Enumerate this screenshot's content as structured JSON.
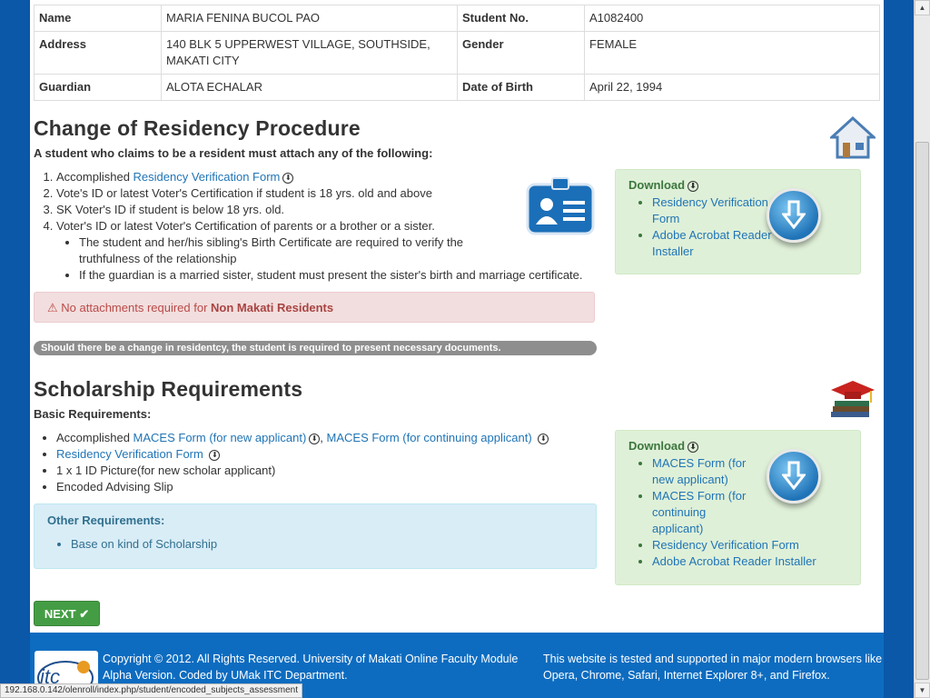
{
  "student": {
    "name_label": "Name",
    "name": "MARIA FENINA BUCOL PAO",
    "studno_label": "Student No.",
    "studno": "A1082400",
    "address_label": "Address",
    "address": "140 BLK 5 UPPERWEST VILLAGE, SOUTHSIDE, MAKATI CITY",
    "gender_label": "Gender",
    "gender": "FEMALE",
    "guardian_label": "Guardian",
    "guardian": "ALOTA ECHALAR",
    "dob_label": "Date of Birth",
    "dob": "April 22, 1994"
  },
  "residency": {
    "title": "Change of Residency Procedure",
    "subtitle": "A student who claims to be a resident must attach any of the following:",
    "item1_prefix": "Accomplished ",
    "item1_link": "Residency Verification Form",
    "item2": "Vote's ID or latest Voter's Certification if student is 18 yrs. old and above",
    "item3": "SK Voter's ID if student is below 18 yrs. old.",
    "item4": "Voter's ID or latest Voter's Certification of parents or a brother or a sister.",
    "sub1": "The student and her/his sibling's Birth Certificate are required to verify the truthfulness of the relationship",
    "sub2": "If the guardian is a married sister, student must present the sister's birth and marriage certificate.",
    "alert_prefix": "No attachments required for ",
    "alert_bold": "Non Makati Residents",
    "bar_text": "Should there be a change in residentcy, the student is required to present necessary documents.",
    "download_title": "Download",
    "downloads": [
      "Residency Verification Form",
      "Adobe Acrobat Reader Installer"
    ]
  },
  "scholarship": {
    "title": "Scholarship Requirements",
    "subtitle": "Basic Requirements:",
    "item1_prefix": "Accomplished ",
    "item1_link1": "MACES Form (for new applicant)",
    "item1_link2": "MACES Form (for continuing applicant)",
    "item2_link": "Residency Verification Form",
    "item3": "1 x 1 ID Picture(for new scholar applicant)",
    "item4": "Encoded Advising Slip",
    "other_title": "Other Requirements:",
    "other_item": "Base on kind of Scholarship",
    "download_title": "Download",
    "downloads": [
      "MACES Form (for new applicant)",
      "MACES Form (for continuing applicant)",
      "Residency Verification Form",
      "Adobe Acrobat Reader Installer"
    ]
  },
  "next_label": "NEXT",
  "footer": {
    "copyright": "Copyright © 2012. All Rights Reserved. University of Makati Online Faculty Module Alpha Version. Coded by UMak ITC Department.",
    "tested": "This website is tested and supported in major modern browsers like Opera, Chrome, Safari, Internet Explorer 8+, and Firefox.",
    "logo_text": "itc"
  },
  "status_url": "192.168.0.142/olenroll/index.php/student/encoded_subjects_assessment"
}
